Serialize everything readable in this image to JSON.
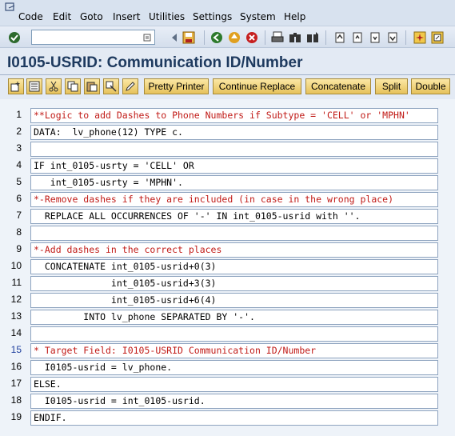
{
  "menu": {
    "items": [
      {
        "id": "code",
        "label": "Code"
      },
      {
        "id": "edit",
        "label": "Edit"
      },
      {
        "id": "goto",
        "label": "Goto"
      },
      {
        "id": "insert",
        "label": "Insert"
      },
      {
        "id": "utilities",
        "label": "Utilities"
      },
      {
        "id": "settings",
        "label": "Settings"
      },
      {
        "id": "system",
        "label": "System"
      },
      {
        "id": "help",
        "label": "Help"
      }
    ]
  },
  "toolbar": {
    "command_field_value": ""
  },
  "page_title": "I0105-USRID: Communication ID/Number",
  "app_toolbar": {
    "buttons": {
      "pretty_printer": "Pretty Printer",
      "continue_replace": "Continue Replace",
      "concatenate": "Concatenate",
      "split": "Split",
      "double": "Double"
    }
  },
  "editor": {
    "lines": [
      {
        "num": "1",
        "text": "**Logic to add Dashes to Phone Numbers if Subtype = 'CELL' or 'MPHN'"
      },
      {
        "num": "2",
        "text": "DATA:  lv_phone(12) TYPE c."
      },
      {
        "num": "3",
        "text": ""
      },
      {
        "num": "4",
        "text": "IF int_0105-usrty = 'CELL' OR"
      },
      {
        "num": "5",
        "text": "   int_0105-usrty = 'MPHN'."
      },
      {
        "num": "6",
        "text": "*-Remove dashes if they are included (in case in the wrong place)"
      },
      {
        "num": "7",
        "text": "  REPLACE ALL OCCURRENCES OF '-' IN int_0105-usrid with ''."
      },
      {
        "num": "8",
        "text": ""
      },
      {
        "num": "9",
        "text": "*-Add dashes in the correct places"
      },
      {
        "num": "10",
        "text": "  CONCATENATE int_0105-usrid+0(3)"
      },
      {
        "num": "11",
        "text": "              int_0105-usrid+3(3)"
      },
      {
        "num": "12",
        "text": "              int_0105-usrid+6(4)"
      },
      {
        "num": "13",
        "text": "         INTO lv_phone SEPARATED BY '-'."
      },
      {
        "num": "14",
        "text": ""
      },
      {
        "num": "15",
        "text": "* Target Field: I0105-USRID Communication ID/Number"
      },
      {
        "num": "16",
        "text": "  I0105-usrid = lv_phone."
      },
      {
        "num": "17",
        "text": "ELSE."
      },
      {
        "num": "18",
        "text": "  I0105-usrid = int_0105-usrid."
      },
      {
        "num": "19",
        "text": "ENDIF."
      }
    ]
  }
}
